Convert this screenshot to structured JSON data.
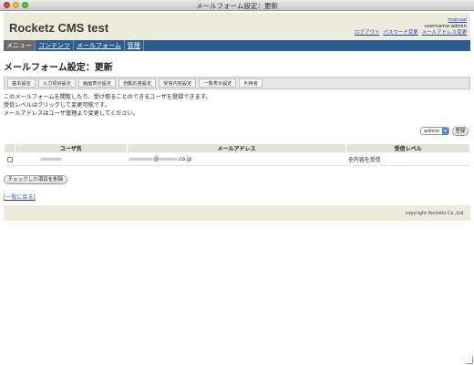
{
  "window": {
    "title": "メールフォーム設定：更新"
  },
  "header": {
    "site_title": "Rocketz CMS test",
    "manual_link": "manual",
    "username": "username:admin",
    "links": [
      "ログアウト",
      "パスワード変更",
      "メールアドレス変更"
    ]
  },
  "nav": [
    "メニュー",
    "コンテンツ",
    "メールフォーム",
    "管理"
  ],
  "page": {
    "title": "メールフォーム設定：更新",
    "tabs": [
      "基本設定",
      "入力項目設定",
      "画面表示設定",
      "自動応答設定",
      "受信内容設定",
      "一覧表示設定",
      "利用者"
    ],
    "active_tab": "利用者",
    "description": [
      "このメールフォームを閲覧したり、受け取ることのできるユーザを登録できます。",
      "受信レベルはクリックして変更可能です。",
      "メールアドレスはユーザ管理より変更してください。"
    ],
    "user_select": {
      "value": "admin"
    },
    "register_button": "登録",
    "table": {
      "headers": [
        "ユーザ名",
        "メールアドレス",
        "受信レベル"
      ],
      "rows": [
        {
          "email_suffix": "@",
          "email_domain": ".co.jp",
          "level": "全内容を受信"
        }
      ]
    },
    "delete_button": "チェックした項目を削除",
    "back_link": "[一覧に戻る]"
  },
  "footer": {
    "copyright": "copyright Rocketz Co.,Ltd."
  },
  "icons": {
    "close": "close-icon",
    "minimize": "minimize-icon",
    "maximize": "maximize-icon",
    "dropdown": "chevron-down-icon",
    "resize": "resize-grip-icon"
  }
}
